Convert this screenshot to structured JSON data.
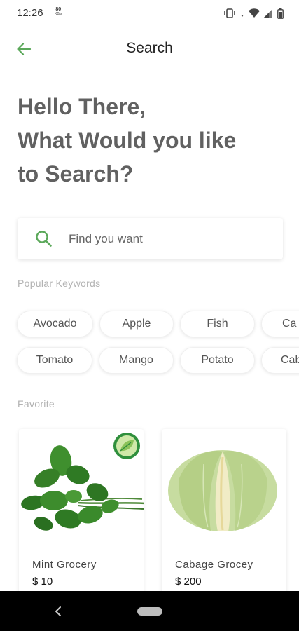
{
  "status_bar": {
    "time": "12:26",
    "speed_value": "80",
    "speed_unit": "KB/s"
  },
  "app_bar": {
    "title": "Search",
    "back_icon": "arrow-left-icon",
    "accent_color": "#5ba85a"
  },
  "hero": {
    "line1": "Hello There,",
    "line2": "What Would you like",
    "line3": "to Search?"
  },
  "search": {
    "placeholder": "Find you want",
    "value": "",
    "icon": "search-icon"
  },
  "popular": {
    "label": "Popular Keywords",
    "rows": [
      [
        "Avocado",
        "Apple",
        "Fish",
        "Ca"
      ],
      [
        "Tomato",
        "Mango",
        "Potato",
        "Cab"
      ]
    ]
  },
  "favorite": {
    "label": "Favorite",
    "items": [
      {
        "name": "Mint Grocery",
        "price": "$ 10",
        "badge": "organic-leaf-badge"
      },
      {
        "name": "Cabage Grocey",
        "price": "$ 200"
      }
    ]
  },
  "nav_bar": {
    "back_icon": "nav-back-icon",
    "home_icon": "nav-home-pill"
  }
}
